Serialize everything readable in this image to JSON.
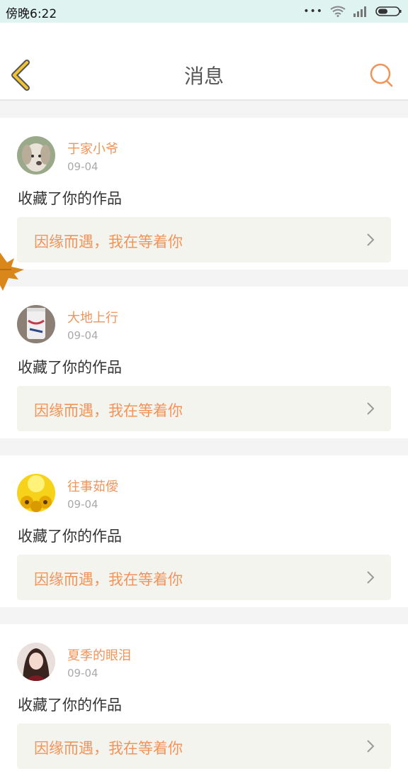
{
  "status_bar": {
    "time": "傍晚6:22"
  },
  "header": {
    "title": "消息"
  },
  "colors": {
    "accent": "#f0945a",
    "back_arrow": "#f2c434",
    "card_link_bg": "#f4f4ef"
  },
  "messages": [
    {
      "username": "于家小爷",
      "date": "09-04",
      "action": "收藏了你的作品",
      "work_title": "因缘而遇，我在等着你"
    },
    {
      "username": "大地上行",
      "date": "09-04",
      "action": "收藏了你的作品",
      "work_title": "因缘而遇，我在等着你"
    },
    {
      "username": "往事茹僾",
      "date": "09-04",
      "action": "收藏了你的作品",
      "work_title": "因缘而遇，我在等着你"
    },
    {
      "username": "夏季的眼泪",
      "date": "09-04",
      "action": "收藏了你的作品",
      "work_title": "因缘而遇，我在等着你"
    }
  ]
}
